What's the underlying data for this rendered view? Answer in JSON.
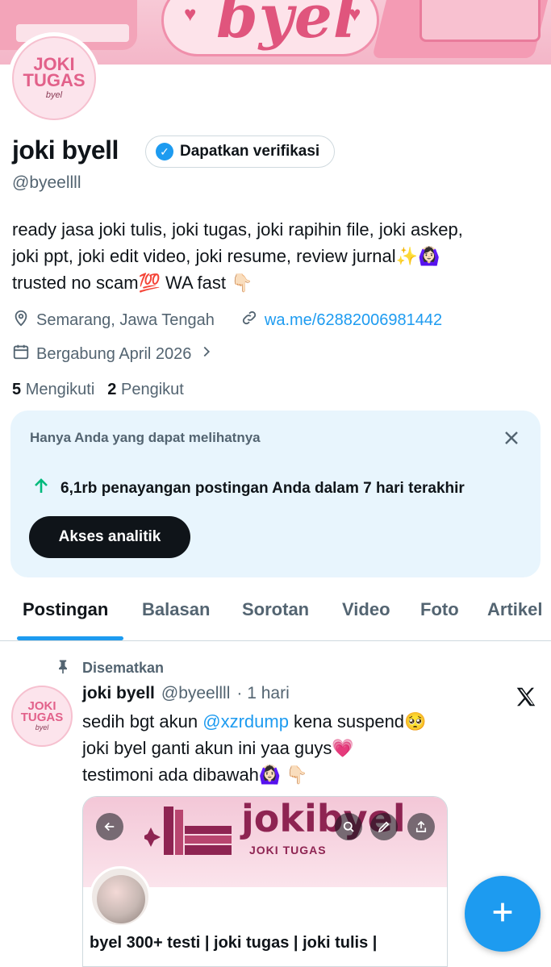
{
  "banner": {
    "word": "byel"
  },
  "avatar": {
    "line1": "JOKI",
    "line2": "TUGAS",
    "line3": "byel"
  },
  "profile": {
    "name": "joki byell",
    "verify_label": "Dapatkan verifikasi",
    "handle": "@byeellll",
    "bio_lines": [
      "ready jasa joki tulis, joki tugas, joki rapihin file, joki askep,",
      "joki ppt, joki edit video, joki resume, review jurnal✨🙆🏻‍♀️",
      "trusted no scam💯 WA fast 👇🏻"
    ],
    "location": "Semarang, Jawa Tengah",
    "website": "wa.me/62882006981442",
    "joined": "Bergabung April 2026",
    "following_count": "5",
    "following_label": "Mengikuti",
    "followers_count": "2",
    "followers_label": "Pengikut"
  },
  "analytics_card": {
    "title": "Hanya Anda yang dapat melihatnya",
    "stat": "6,1rb penayangan postingan Anda dalam 7 hari terakhir",
    "button_label": "Akses analitik"
  },
  "tabs": [
    "Postingan",
    "Balasan",
    "Sorotan",
    "Video",
    "Foto",
    "Artikel"
  ],
  "active_tab": "Postingan",
  "post": {
    "pinned_label": "Disematkan",
    "author_name": "joki byell",
    "author_handle": "@byeellll",
    "time": "· 1 hari",
    "text_line1_before": "sedih bgt akun ",
    "text_line1_mention": "@xzrdump",
    "text_line1_after": " kena suspend🥺",
    "text_line2": "joki byel ganti akun ini yaa guys💗",
    "text_line3": "testimoni ada dibawah🙆🏻‍♀️ 👇🏻",
    "media": {
      "banner_word": "jokibyel",
      "banner_sub": "JOKI TUGAS",
      "title": "byel 300+ testi | joki tugas | joki tulis |"
    }
  },
  "colors": {
    "accent": "#1d9bf0",
    "text": "#0f1419",
    "secondary": "#536471",
    "card_bg": "#e8f5fd"
  },
  "icons": [
    "location-icon",
    "link-icon",
    "calendar-icon",
    "chevron-right-icon",
    "close-icon",
    "arrow-up-icon",
    "pin-icon",
    "x-logo-icon",
    "back-arrow-icon",
    "search-icon",
    "edit-icon",
    "share-icon",
    "plus-icon",
    "verified-badge-icon"
  ]
}
